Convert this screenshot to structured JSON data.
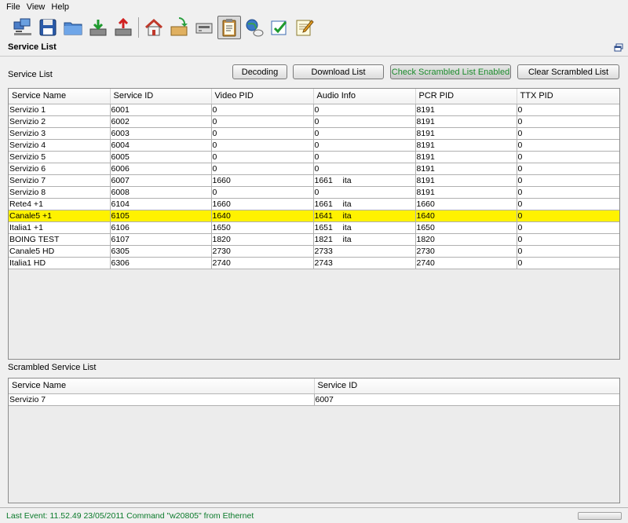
{
  "menu": [
    "File",
    "View",
    "Help"
  ],
  "toolbar": {
    "buttons": [
      {
        "name": "network-pc-icon",
        "active": false
      },
      {
        "name": "floppy-save-icon",
        "active": false
      },
      {
        "name": "folder-open-icon",
        "active": false
      },
      {
        "name": "download-tray-icon",
        "active": false
      },
      {
        "name": "upload-tray-icon",
        "active": false
      },
      {
        "name": "home-icon",
        "active": false
      },
      {
        "name": "box-arrow-icon",
        "active": false
      },
      {
        "name": "device-receiver-icon",
        "active": false
      },
      {
        "name": "clipboard-icon",
        "active": true
      },
      {
        "name": "globe-search-icon",
        "active": false
      },
      {
        "name": "checklist-icon",
        "active": false
      },
      {
        "name": "notepad-pencil-icon",
        "active": false
      }
    ]
  },
  "panel": {
    "title": "Service List"
  },
  "service_list": {
    "label": "Service List",
    "buttons": {
      "decoding": "Decoding",
      "download": "Download List",
      "check_scrambled": "Check Scrambled List Enabled",
      "clear_scrambled": "Clear Scrambled List"
    },
    "columns": [
      "Service Name",
      "Service ID",
      "Video PID",
      "Audio Info",
      "PCR PID",
      "TTX PID"
    ],
    "rows": [
      {
        "name": "Servizio 1",
        "id": "6001",
        "video": "0",
        "audio": "0",
        "lang": "",
        "pcr": "8191",
        "ttx": "0",
        "selected": false
      },
      {
        "name": "Servizio 2",
        "id": "6002",
        "video": "0",
        "audio": "0",
        "lang": "",
        "pcr": "8191",
        "ttx": "0",
        "selected": false
      },
      {
        "name": "Servizio 3",
        "id": "6003",
        "video": "0",
        "audio": "0",
        "lang": "",
        "pcr": "8191",
        "ttx": "0",
        "selected": false
      },
      {
        "name": "Servizio 4",
        "id": "6004",
        "video": "0",
        "audio": "0",
        "lang": "",
        "pcr": "8191",
        "ttx": "0",
        "selected": false
      },
      {
        "name": "Servizio 5",
        "id": "6005",
        "video": "0",
        "audio": "0",
        "lang": "",
        "pcr": "8191",
        "ttx": "0",
        "selected": false
      },
      {
        "name": "Servizio 6",
        "id": "6006",
        "video": "0",
        "audio": "0",
        "lang": "",
        "pcr": "8191",
        "ttx": "0",
        "selected": false
      },
      {
        "name": "Servizio 7",
        "id": "6007",
        "video": "1660",
        "audio": "1661",
        "lang": "ita",
        "pcr": "8191",
        "ttx": "0",
        "selected": false
      },
      {
        "name": "Servizio 8",
        "id": "6008",
        "video": "0",
        "audio": "0",
        "lang": "",
        "pcr": "8191",
        "ttx": "0",
        "selected": false
      },
      {
        "name": "Rete4 +1",
        "id": "6104",
        "video": "1660",
        "audio": "1661",
        "lang": "ita",
        "pcr": "1660",
        "ttx": "0",
        "selected": false
      },
      {
        "name": "Canale5 +1",
        "id": "6105",
        "video": "1640",
        "audio": "1641",
        "lang": "ita",
        "pcr": "1640",
        "ttx": "0",
        "selected": true
      },
      {
        "name": "Italia1 +1",
        "id": "6106",
        "video": "1650",
        "audio": "1651",
        "lang": "ita",
        "pcr": "1650",
        "ttx": "0",
        "selected": false
      },
      {
        "name": "BOING TEST",
        "id": "6107",
        "video": "1820",
        "audio": "1821",
        "lang": "ita",
        "pcr": "1820",
        "ttx": "0",
        "selected": false
      },
      {
        "name": "Canale5 HD",
        "id": "6305",
        "video": "2730",
        "audio": "2733",
        "lang": "",
        "pcr": "2730",
        "ttx": "0",
        "selected": false
      },
      {
        "name": "Italia1 HD",
        "id": "6306",
        "video": "2740",
        "audio": "2743",
        "lang": "",
        "pcr": "2740",
        "ttx": "0",
        "selected": false
      }
    ]
  },
  "scrambled_list": {
    "label": "Scrambled Service List",
    "columns": [
      "Service Name",
      "Service ID"
    ],
    "rows": [
      {
        "name": "Servizio 7",
        "id": "6007"
      }
    ]
  },
  "status": {
    "text": "Last Event:  11.52.49    23/05/2011 Command \"w20805\" from Ethernet"
  },
  "colors": {
    "selected_row": "#fff200",
    "enabled_text": "#1a8a2a",
    "status_text": "#0a7a2a"
  }
}
